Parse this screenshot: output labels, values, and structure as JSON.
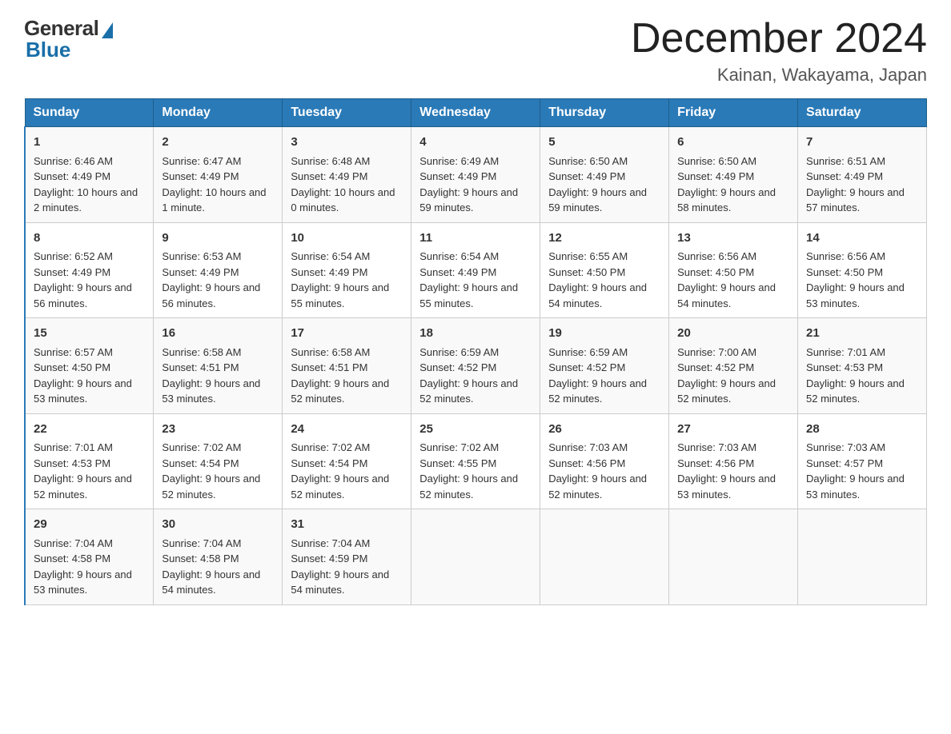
{
  "header": {
    "logo_general": "General",
    "logo_blue": "Blue",
    "month_title": "December 2024",
    "location": "Kainan, Wakayama, Japan"
  },
  "days_of_week": [
    "Sunday",
    "Monday",
    "Tuesday",
    "Wednesday",
    "Thursday",
    "Friday",
    "Saturday"
  ],
  "weeks": [
    [
      {
        "day": "1",
        "sunrise": "6:46 AM",
        "sunset": "4:49 PM",
        "daylight": "10 hours and 2 minutes."
      },
      {
        "day": "2",
        "sunrise": "6:47 AM",
        "sunset": "4:49 PM",
        "daylight": "10 hours and 1 minute."
      },
      {
        "day": "3",
        "sunrise": "6:48 AM",
        "sunset": "4:49 PM",
        "daylight": "10 hours and 0 minutes."
      },
      {
        "day": "4",
        "sunrise": "6:49 AM",
        "sunset": "4:49 PM",
        "daylight": "9 hours and 59 minutes."
      },
      {
        "day": "5",
        "sunrise": "6:50 AM",
        "sunset": "4:49 PM",
        "daylight": "9 hours and 59 minutes."
      },
      {
        "day": "6",
        "sunrise": "6:50 AM",
        "sunset": "4:49 PM",
        "daylight": "9 hours and 58 minutes."
      },
      {
        "day": "7",
        "sunrise": "6:51 AM",
        "sunset": "4:49 PM",
        "daylight": "9 hours and 57 minutes."
      }
    ],
    [
      {
        "day": "8",
        "sunrise": "6:52 AM",
        "sunset": "4:49 PM",
        "daylight": "9 hours and 56 minutes."
      },
      {
        "day": "9",
        "sunrise": "6:53 AM",
        "sunset": "4:49 PM",
        "daylight": "9 hours and 56 minutes."
      },
      {
        "day": "10",
        "sunrise": "6:54 AM",
        "sunset": "4:49 PM",
        "daylight": "9 hours and 55 minutes."
      },
      {
        "day": "11",
        "sunrise": "6:54 AM",
        "sunset": "4:49 PM",
        "daylight": "9 hours and 55 minutes."
      },
      {
        "day": "12",
        "sunrise": "6:55 AM",
        "sunset": "4:50 PM",
        "daylight": "9 hours and 54 minutes."
      },
      {
        "day": "13",
        "sunrise": "6:56 AM",
        "sunset": "4:50 PM",
        "daylight": "9 hours and 54 minutes."
      },
      {
        "day": "14",
        "sunrise": "6:56 AM",
        "sunset": "4:50 PM",
        "daylight": "9 hours and 53 minutes."
      }
    ],
    [
      {
        "day": "15",
        "sunrise": "6:57 AM",
        "sunset": "4:50 PM",
        "daylight": "9 hours and 53 minutes."
      },
      {
        "day": "16",
        "sunrise": "6:58 AM",
        "sunset": "4:51 PM",
        "daylight": "9 hours and 53 minutes."
      },
      {
        "day": "17",
        "sunrise": "6:58 AM",
        "sunset": "4:51 PM",
        "daylight": "9 hours and 52 minutes."
      },
      {
        "day": "18",
        "sunrise": "6:59 AM",
        "sunset": "4:52 PM",
        "daylight": "9 hours and 52 minutes."
      },
      {
        "day": "19",
        "sunrise": "6:59 AM",
        "sunset": "4:52 PM",
        "daylight": "9 hours and 52 minutes."
      },
      {
        "day": "20",
        "sunrise": "7:00 AM",
        "sunset": "4:52 PM",
        "daylight": "9 hours and 52 minutes."
      },
      {
        "day": "21",
        "sunrise": "7:01 AM",
        "sunset": "4:53 PM",
        "daylight": "9 hours and 52 minutes."
      }
    ],
    [
      {
        "day": "22",
        "sunrise": "7:01 AM",
        "sunset": "4:53 PM",
        "daylight": "9 hours and 52 minutes."
      },
      {
        "day": "23",
        "sunrise": "7:02 AM",
        "sunset": "4:54 PM",
        "daylight": "9 hours and 52 minutes."
      },
      {
        "day": "24",
        "sunrise": "7:02 AM",
        "sunset": "4:54 PM",
        "daylight": "9 hours and 52 minutes."
      },
      {
        "day": "25",
        "sunrise": "7:02 AM",
        "sunset": "4:55 PM",
        "daylight": "9 hours and 52 minutes."
      },
      {
        "day": "26",
        "sunrise": "7:03 AM",
        "sunset": "4:56 PM",
        "daylight": "9 hours and 52 minutes."
      },
      {
        "day": "27",
        "sunrise": "7:03 AM",
        "sunset": "4:56 PM",
        "daylight": "9 hours and 53 minutes."
      },
      {
        "day": "28",
        "sunrise": "7:03 AM",
        "sunset": "4:57 PM",
        "daylight": "9 hours and 53 minutes."
      }
    ],
    [
      {
        "day": "29",
        "sunrise": "7:04 AM",
        "sunset": "4:58 PM",
        "daylight": "9 hours and 53 minutes."
      },
      {
        "day": "30",
        "sunrise": "7:04 AM",
        "sunset": "4:58 PM",
        "daylight": "9 hours and 54 minutes."
      },
      {
        "day": "31",
        "sunrise": "7:04 AM",
        "sunset": "4:59 PM",
        "daylight": "9 hours and 54 minutes."
      },
      null,
      null,
      null,
      null
    ]
  ]
}
